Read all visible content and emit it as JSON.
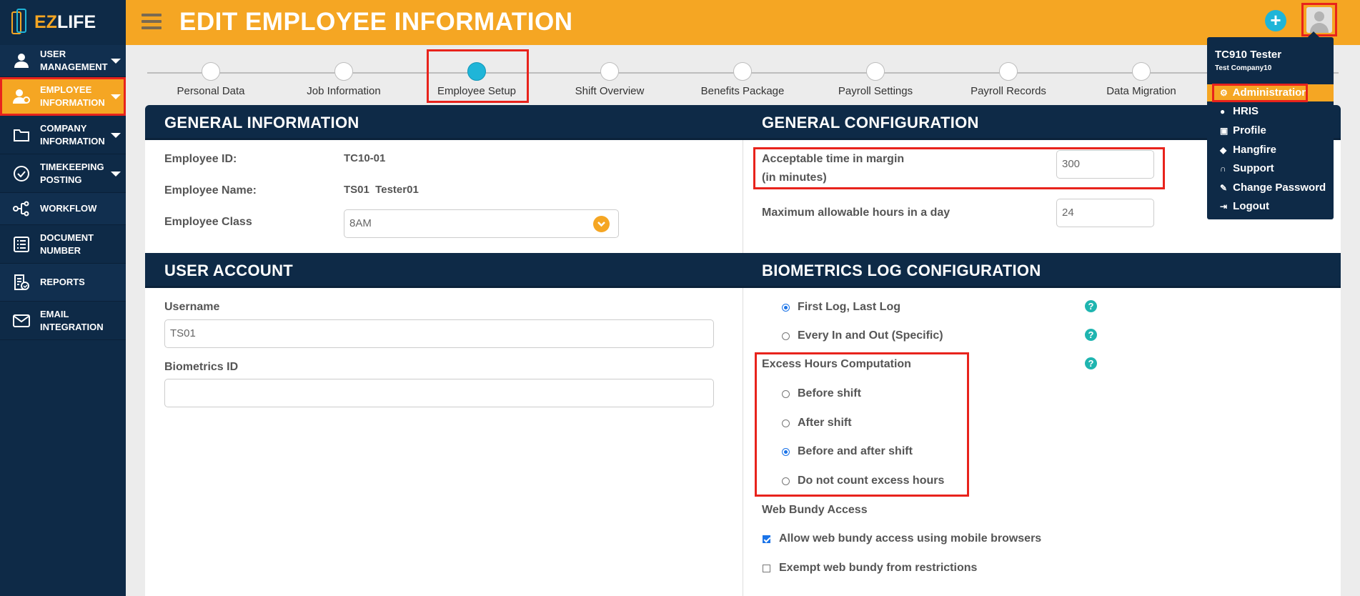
{
  "app": {
    "logo_ez": "EZ",
    "logo_life": "LIFE"
  },
  "header": {
    "title": "EDIT EMPLOYEE INFORMATION",
    "add_icon": "+"
  },
  "sidebar": {
    "items": [
      {
        "label": "USER MANAGEMENT",
        "icon": "user-icon"
      },
      {
        "label": "EMPLOYEE INFORMATION",
        "icon": "employee-icon"
      },
      {
        "label": "COMPANY INFORMATION",
        "icon": "folder-icon"
      },
      {
        "label": "TIMEKEEPING POSTING",
        "icon": "check-circle-icon"
      },
      {
        "label": "WORKFLOW",
        "icon": "workflow-icon"
      },
      {
        "label": "DOCUMENT NUMBER",
        "icon": "list-icon"
      },
      {
        "label": "REPORTS",
        "icon": "report-icon"
      },
      {
        "label": "EMAIL INTEGRATION",
        "icon": "mail-icon"
      }
    ]
  },
  "steps": [
    {
      "label": "Personal Data"
    },
    {
      "label": "Job Information"
    },
    {
      "label": "Employee Setup"
    },
    {
      "label": "Shift Overview"
    },
    {
      "label": "Benefits Package"
    },
    {
      "label": "Payroll Settings"
    },
    {
      "label": "Payroll Records"
    },
    {
      "label": "Data Migration"
    }
  ],
  "general_info": {
    "title": "GENERAL INFORMATION",
    "employee_id_label": "Employee ID:",
    "employee_id": "TC10-01",
    "employee_name_label": "Employee Name:",
    "employee_name": "TS01  Tester01",
    "employee_class_label": "Employee Class",
    "employee_class": "8AM"
  },
  "user_account": {
    "title": "USER ACCOUNT",
    "username_label": "Username",
    "username": "TS01",
    "biometrics_label": "Biometrics ID",
    "biometrics_id": ""
  },
  "general_config": {
    "title": "GENERAL CONFIGURATION",
    "margin_label_1": "Acceptable time in margin",
    "margin_label_2": "(in minutes)",
    "margin_value": "300",
    "max_hours_label": "Maximum allowable hours in a day",
    "max_hours_value": "24"
  },
  "biometrics_config": {
    "title": "BIOMETRICS LOG CONFIGURATION",
    "options": [
      {
        "label": "First Log, Last Log",
        "selected": true
      },
      {
        "label": "Every In and Out (Specific)",
        "selected": false
      }
    ],
    "excess_title": "Excess Hours Computation",
    "excess_options": [
      {
        "label": "Before shift",
        "selected": false
      },
      {
        "label": "After shift",
        "selected": false
      },
      {
        "label": "Before and after shift",
        "selected": true
      },
      {
        "label": "Do not count excess hours",
        "selected": false
      }
    ],
    "web_bundy_title": "Web Bundy Access",
    "web_bundy_options": [
      {
        "label": "Allow web bundy access using mobile browsers",
        "checked": true
      },
      {
        "label": "Exempt web bundy from restrictions",
        "checked": false
      }
    ],
    "help_glyph": "?"
  },
  "user_menu": {
    "user_name": "TC910 Tester",
    "company": "Test Company10",
    "items": [
      {
        "label": "Administration",
        "icon": "gear-icon"
      },
      {
        "label": "HRIS",
        "icon": "person-icon"
      },
      {
        "label": "Profile",
        "icon": "id-card-icon"
      },
      {
        "label": "Hangfire",
        "icon": "tags-icon"
      },
      {
        "label": "Support",
        "icon": "headset-icon"
      },
      {
        "label": "Change Password",
        "icon": "pencil-icon"
      },
      {
        "label": "Logout",
        "icon": "logout-icon"
      }
    ]
  },
  "colors": {
    "accent": "#f5a623",
    "navy": "#0e2a47",
    "teal": "#1fb5d8",
    "highlight": "#e8231c"
  }
}
